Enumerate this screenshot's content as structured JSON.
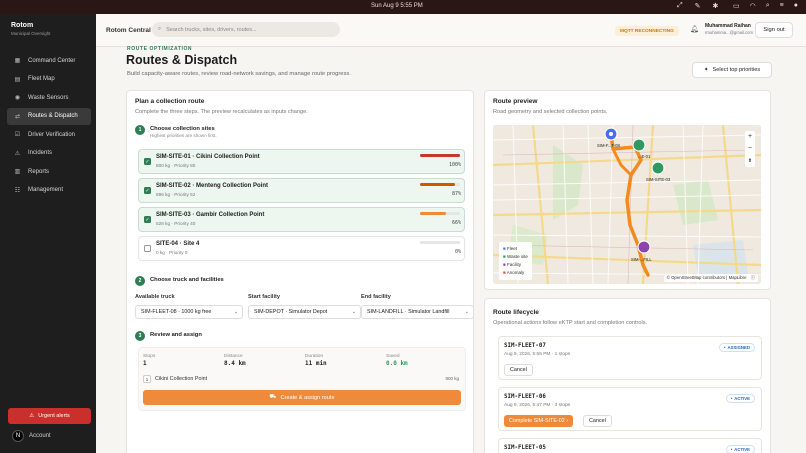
{
  "menubar": {
    "clock": "Sun Aug 9   5:55 PM"
  },
  "sidebar": {
    "brand": "Rotom",
    "brand_sub": "Municipal Oversight",
    "items": [
      {
        "label": "Command Center",
        "icon": "grid-icon",
        "glyph": "▦"
      },
      {
        "label": "Fleet Map",
        "icon": "map-icon",
        "glyph": "▤"
      },
      {
        "label": "Waste Sensors",
        "icon": "sensor-icon",
        "glyph": "◉"
      },
      {
        "label": "Routes & Dispatch",
        "icon": "route-icon",
        "glyph": "⇄"
      },
      {
        "label": "Driver Verification",
        "icon": "verify-icon",
        "glyph": "☑"
      },
      {
        "label": "Incidents",
        "icon": "alert-icon",
        "glyph": "⚠"
      },
      {
        "label": "Reports",
        "icon": "chart-icon",
        "glyph": "▥"
      },
      {
        "label": "Management",
        "icon": "users-icon",
        "glyph": "☷"
      }
    ],
    "urgent_label": "Urgent alerts",
    "account_label": "Account",
    "avatar_letter": "N"
  },
  "topbar": {
    "app_name": "Rotom Central",
    "search_placeholder": "Search trucks, sites, drivers, routes...",
    "mqtt_status": "MQTT RECONNECTING",
    "user_name": "Muhammad Raihan",
    "user_email": "rmuhamma...@gmail.com",
    "sign_out": "Sign out"
  },
  "page": {
    "eyebrow": "ROUTE OPTIMIZATION",
    "title": "Routes & Dispatch",
    "description": "Build capacity-aware routes, review road-network savings, and manage route progress.",
    "select_top": "Select top priorities"
  },
  "plan": {
    "title": "Plan a collection route",
    "subtitle": "Complete the three steps. The preview recalculates as inputs change.",
    "step1": {
      "num": "1",
      "title": "Choose collection sites",
      "sub": "Highest priorities are shown first."
    },
    "sites": [
      {
        "name": "SIM-SITE-01 · Cikini Collection Point",
        "meta": "800 kg · Priority 80",
        "pct": "100%",
        "fill": 1.0,
        "color": "#c0392b",
        "checked": true
      },
      {
        "name": "SIM-SITE-02 · Menteng Collection Point",
        "meta": "896 kg · Priority 52",
        "pct": "87%",
        "fill": 0.87,
        "color": "#d35400",
        "checked": true
      },
      {
        "name": "SIM-SITE-03 · Gambir Collection Point",
        "meta": "528 kg · Priority 40",
        "pct": "66%",
        "fill": 0.66,
        "color": "#ee8a3a",
        "checked": true
      },
      {
        "name": "SITE-04 · Site 4",
        "meta": "0 kg · Priority 0",
        "pct": "0%",
        "fill": 0.0,
        "color": "#ccc",
        "checked": false
      }
    ],
    "step2": {
      "num": "2",
      "title": "Choose truck and facilities"
    },
    "truck_label": "Available truck",
    "truck_value": "SIM-FLEET-08 · 1000 kg free",
    "start_label": "Start facility",
    "start_value": "SIM-DEPOT · Simulator Depot",
    "end_label": "End facility",
    "end_value": "SIM-LANDFILL · Simulator Landfill",
    "step3": {
      "num": "3",
      "title": "Review and assign"
    },
    "stats": [
      {
        "k": "Stops",
        "v": "1"
      },
      {
        "k": "Distance",
        "v": "8.4 km"
      },
      {
        "k": "Duration",
        "v": "11 min"
      },
      {
        "k": "Saved",
        "v": "0.0 km"
      }
    ],
    "sequence": {
      "index": "1",
      "name": "Cikini Collection Point",
      "weight": "800 kg"
    },
    "create_label": "Create & assign route"
  },
  "preview": {
    "title": "Route preview",
    "subtitle": "Road geometry and selected collection points.",
    "legend": [
      {
        "label": "Fleet",
        "color": "#4a6cf7"
      },
      {
        "label": "Waste site",
        "color": "#2f9a5f"
      },
      {
        "label": "Facility",
        "color": "#8e44ad"
      },
      {
        "label": "Anomaly",
        "color": "#e74c3c"
      }
    ],
    "attribution": "© OpenStreetMap contributors | MapLibre",
    "zoom_in": "+",
    "zoom_out": "−",
    "north": "⬆",
    "markers": {
      "fleet": "SIM-F...T-08",
      "site1": "...E-01",
      "site3": "SIM-SITE-03",
      "landfill": "SIM-...FILL"
    }
  },
  "lifecycle": {
    "title": "Route lifecycle",
    "subtitle": "Operational actions follow eKTP start and completion controls.",
    "items": [
      {
        "id": "SIM-FLEET-07",
        "date": "Aug 9, 2026, 5:55 PM · 1 stops",
        "status": "ASSIGNED",
        "action": "Cancel"
      },
      {
        "id": "SIM-FLEET-06",
        "date": "Aug 9, 2026, 5:47 PM · 3 stops",
        "status": "ACTIVE",
        "primary": "Complete SIM-SITE-02 ›",
        "action": "Cancel"
      },
      {
        "id": "SIM-FLEET-05",
        "status": "ACTIVE"
      }
    ]
  }
}
